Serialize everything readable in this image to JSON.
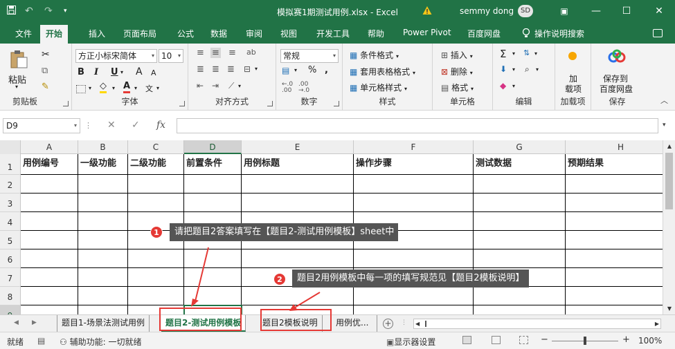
{
  "window": {
    "title": "模拟赛1期测试用例.xlsx - Excel",
    "user_name": "semmy dong",
    "user_initials": "SD",
    "accent_color": "#217346"
  },
  "ribbon_tabs": [
    "文件",
    "开始",
    "插入",
    "页面布局",
    "公式",
    "数据",
    "审阅",
    "视图",
    "开发工具",
    "帮助",
    "Power Pivot",
    "百度网盘",
    "操作说明搜索"
  ],
  "ribbon": {
    "clipboard": {
      "label": "剪贴板",
      "paste": "粘贴"
    },
    "font": {
      "label": "字体",
      "font_name": "方正小标宋简体",
      "font_size": "10",
      "bold": "B",
      "italic": "I",
      "underline": "U",
      "grow": "A",
      "shrink": "A",
      "phonetic": "文"
    },
    "alignment": {
      "label": "对齐方式"
    },
    "number": {
      "label": "数字",
      "format": "常规",
      "percent": "%",
      "comma": ","
    },
    "styles": {
      "label": "样式",
      "conditional": "条件格式",
      "table_format": "套用表格格式",
      "cell_styles": "单元格样式"
    },
    "cells": {
      "label": "单元格",
      "insert": "插入",
      "delete": "删除",
      "format": "格式"
    },
    "editing": {
      "label": "编辑"
    },
    "addins": {
      "label": "加载项",
      "button_line1": "加",
      "button_line2": "载项"
    },
    "save": {
      "label": "保存",
      "button_line1": "保存到",
      "button_line2": "百度网盘"
    }
  },
  "formula_bar": {
    "name_box": "D9",
    "cancel": "✕",
    "enter": "✓",
    "fx": "fx",
    "value": ""
  },
  "grid": {
    "columns": [
      "A",
      "B",
      "C",
      "D",
      "E",
      "F",
      "G",
      "H"
    ],
    "rows": [
      "1",
      "2",
      "3",
      "4",
      "5",
      "6",
      "7",
      "8",
      "9"
    ],
    "header_cells": [
      "用例编号",
      "一级功能",
      "二级功能",
      "前置条件",
      "用例标题",
      "操作步骤",
      "测试数据",
      "预期结果"
    ],
    "selected_cell": "D9"
  },
  "sheet_tabs": [
    "题目1-场景法测试用例",
    "题目2-测试用例模板",
    "题目2模板说明",
    "用例优..."
  ],
  "active_sheet": "题目2-测试用例模板",
  "status": {
    "ready": "就绪",
    "accessibility": "辅助功能: 一切就绪",
    "display": "显示器设置",
    "zoom": "100%"
  },
  "callouts": [
    {
      "number": "1",
      "text": "请把题目2答案填写在【题目2-测试用例模板】sheet中"
    },
    {
      "number": "2",
      "text": "题目2用例模板中每一项的填写规范见【题目2模板说明】"
    }
  ]
}
